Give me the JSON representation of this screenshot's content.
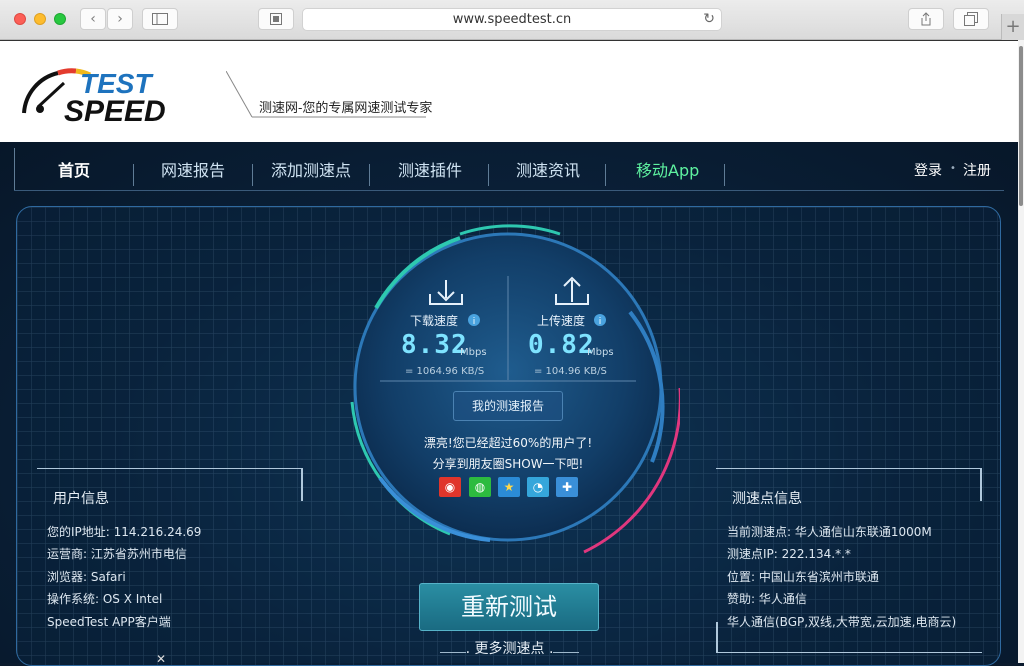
{
  "browser": {
    "url": "www.speedtest.cn",
    "new_tab": "+"
  },
  "header": {
    "logo_test": "TEST",
    "logo_speed": "SPEED",
    "slogan": "测速网-您的专属网速测试专家"
  },
  "nav": {
    "items": [
      "首页",
      "网速报告",
      "添加测速点",
      "测速插件",
      "测速资讯",
      "移动App"
    ],
    "login": "登录",
    "register": "注册",
    "dot": "•"
  },
  "gauge": {
    "download_label": "下载速度",
    "download_value": "8.32",
    "download_unit": "Mbps",
    "download_kbs": "= 1064.96  KB/S",
    "upload_label": "上传速度",
    "upload_value": "0.82",
    "upload_unit": "Mbps",
    "upload_kbs": "= 104.96  KB/S",
    "report_button": "我的测速报告",
    "msg_line1": "漂亮!您已经超过60%的用户了!",
    "msg_line2": "分享到朋友圈SHOW一下吧!"
  },
  "user_info": {
    "title": "用户信息",
    "rows": [
      "您的IP地址:   114.216.24.69",
      "运营商:   江苏省苏州市电信",
      "浏览器:   Safari",
      "操作系统:   OS X Intel",
      "SpeedTest APP客户端"
    ]
  },
  "node_info": {
    "title": "测速点信息",
    "rows": [
      "当前测速点:   华人通信山东联通1000M",
      "测速点IP:   222.134.*.*",
      "位置:   中国山东省滨州市联通",
      "赞助:   华人通信",
      "华人通信(BGP,双线,大带宽,云加速,电商云)"
    ]
  },
  "actions": {
    "retest": "重新测试",
    "more": "更多测速点"
  },
  "colors": {
    "accent": "#7ee3ff",
    "nav_app": "#5ef2a0",
    "retest": "#1f7f96"
  }
}
